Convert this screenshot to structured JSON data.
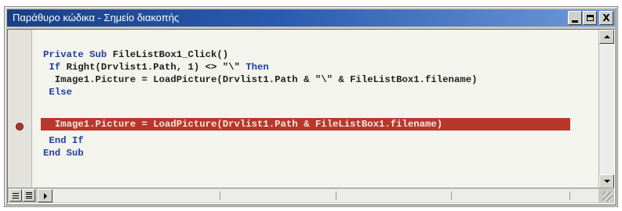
{
  "window": {
    "title": "Παράθυρο κώδικα - Σημείο διακοπής",
    "buttons": {
      "minimize_icon": "minimize-icon",
      "maximize_icon": "maximize-icon",
      "close_label": "X"
    }
  },
  "code": {
    "lines": [
      "Private Sub FileListBox1_Click()",
      " If Right(Drvlist1.Path, 1) <> \"\\\" Then",
      "  Image1.Picture = LoadPicture(Drvlist1.Path & \"\\\" & FileListBox1.filename)",
      " Else",
      "  Image1.Picture = LoadPicture(Drvlist1.Path & FileListBox1.filename)",
      " End If",
      "End Sub"
    ],
    "highlighted_line_index": 4
  },
  "breakpoint": {
    "icon": "breakpoint-dot-icon",
    "line_index": 4
  },
  "colors": {
    "titlebar_start": "#1a3f86",
    "titlebar_end": "#6f9ad8",
    "keyword": "#2040a0",
    "breakpoint_highlight": "#b9372a",
    "code_background": "#f4f4ee"
  },
  "bottom_bar": {
    "procedure_view_icon": "procedure-view-icon",
    "full_module_view_icon": "full-module-view-icon"
  }
}
